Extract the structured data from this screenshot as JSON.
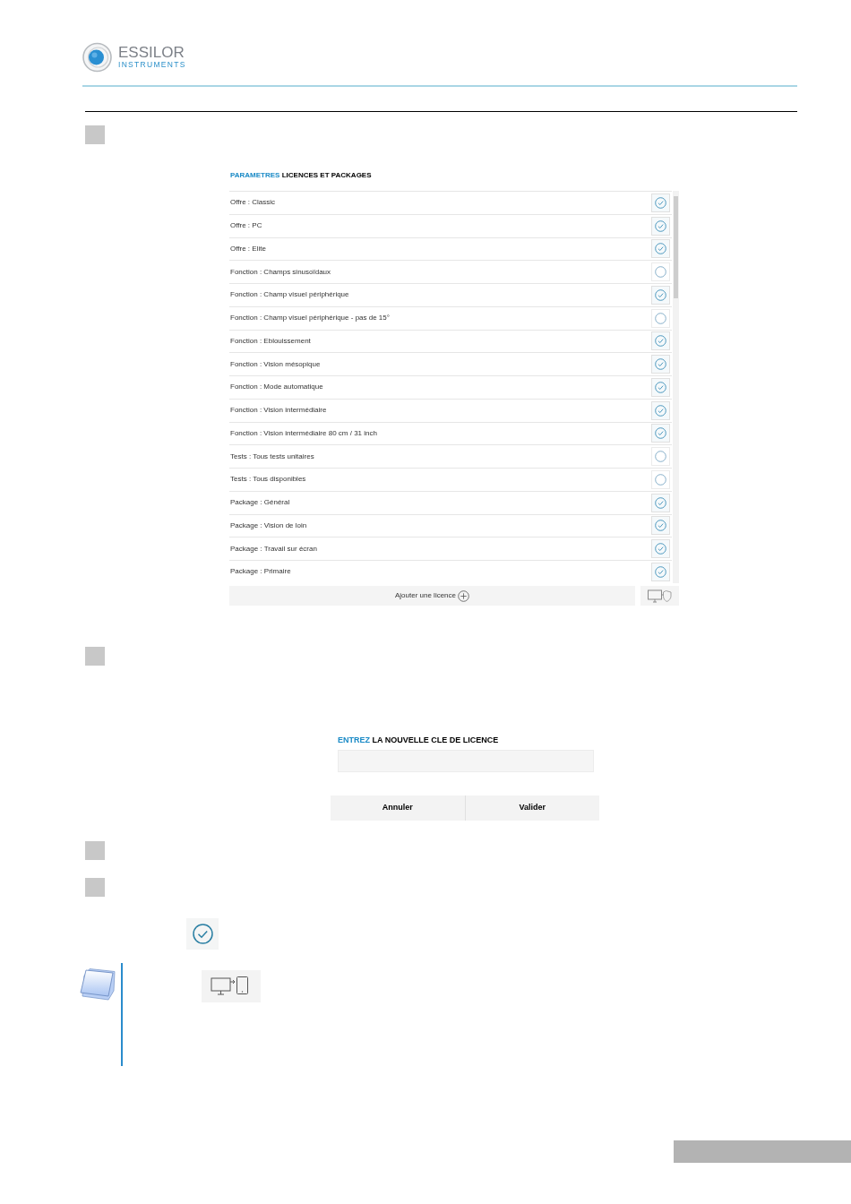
{
  "header": {
    "logo": {
      "wordmark": "ESSILOR",
      "subtitle": "INSTRUMENTS"
    }
  },
  "license_panel": {
    "title_accent": "PARAMETRES",
    "title": "LICENCES ET PACKAGES",
    "rows": [
      {
        "label": "Offre : Classic",
        "checked": true
      },
      {
        "label": "Offre : PC",
        "checked": true
      },
      {
        "label": "Offre : Elite",
        "checked": true
      },
      {
        "label": "Fonction : Champs sinusoïdaux",
        "checked": false
      },
      {
        "label": "Fonction : Champ visuel périphérique",
        "checked": true
      },
      {
        "label": "Fonction : Champ visuel périphérique - pas de 15°",
        "checked": false
      },
      {
        "label": "Fonction : Eblouissement",
        "checked": true
      },
      {
        "label": "Fonction : Vision mésopique",
        "checked": true
      },
      {
        "label": "Fonction : Mode automatique",
        "checked": true
      },
      {
        "label": "Fonction : Vision intermédiaire",
        "checked": true
      },
      {
        "label": "Fonction : Vision intermédiaire 80 cm / 31 inch",
        "checked": true
      },
      {
        "label": "Tests : Tous tests unitaires",
        "checked": false
      },
      {
        "label": "Tests : Tous disponibles",
        "checked": false
      },
      {
        "label": "Package : Général",
        "checked": true
      },
      {
        "label": "Package : Vision de loin",
        "checked": true
      },
      {
        "label": "Package : Travail sur écran",
        "checked": true
      },
      {
        "label": "Package : Primaire",
        "checked": true
      }
    ],
    "add_button": "Ajouter une licence"
  },
  "license_key_dialog": {
    "title_accent": "ENTREZ",
    "title": "LA NOUVELLE CLE DE LICENCE",
    "buttons": [
      "Annuler",
      "Valider"
    ]
  }
}
